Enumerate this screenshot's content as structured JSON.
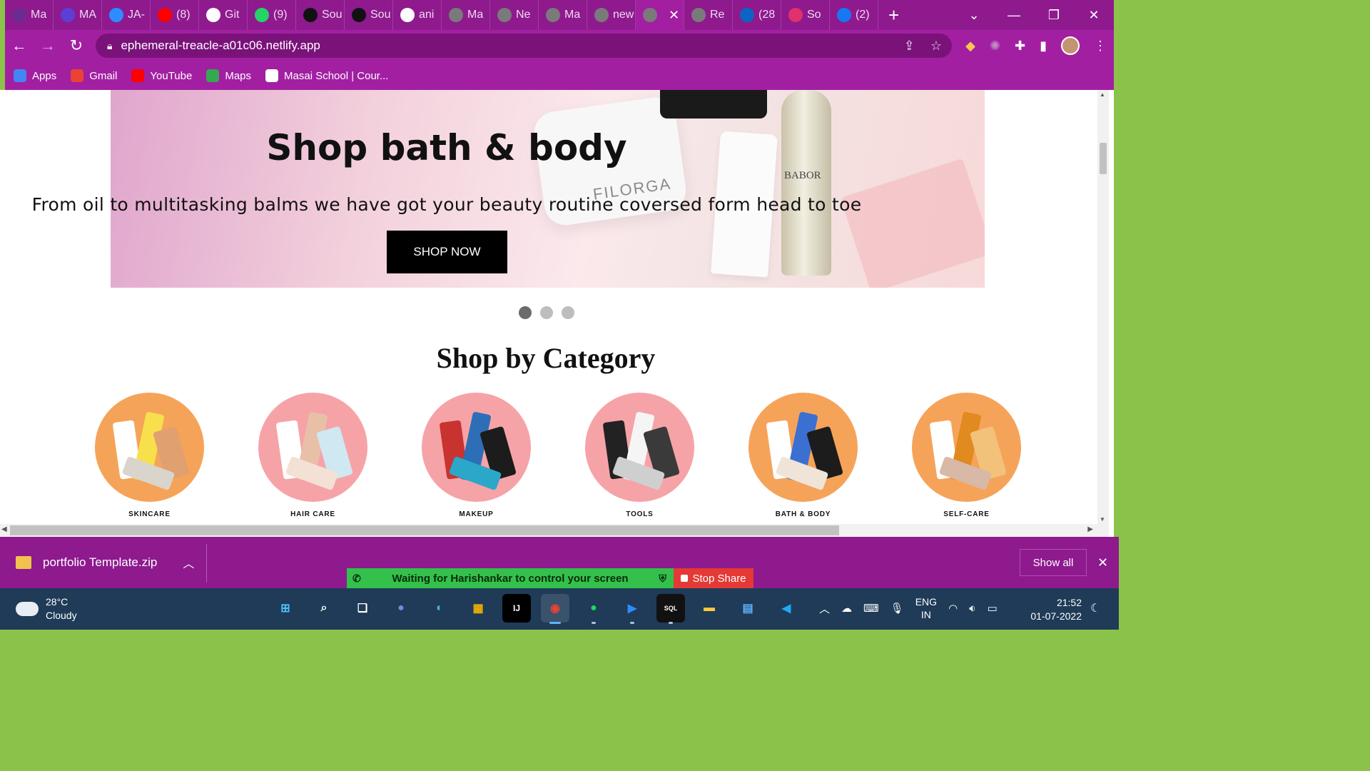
{
  "browser": {
    "tabs": [
      {
        "label": "Ma",
        "icon": "masai-icon",
        "color": "#6a2c91"
      },
      {
        "label": "MA",
        "icon": "list-icon",
        "color": "#5c3fd6"
      },
      {
        "label": "JA-",
        "icon": "zoom-icon",
        "color": "#2d8cff"
      },
      {
        "label": "(8)",
        "icon": "youtube-icon",
        "color": "#ff0000"
      },
      {
        "label": "Git",
        "icon": "mg-icon",
        "color": "#ffffff"
      },
      {
        "label": "(9)",
        "icon": "whatsapp-icon",
        "color": "#25d366"
      },
      {
        "label": "Sou",
        "icon": "github-icon",
        "color": "#111111"
      },
      {
        "label": "Sou",
        "icon": "github-icon",
        "color": "#111111"
      },
      {
        "label": "ani",
        "icon": "google-icon",
        "color": "#ffffff"
      },
      {
        "label": "Ma",
        "icon": "globe-icon",
        "color": "#7a7a7a"
      },
      {
        "label": "Ne",
        "icon": "chrome-icon",
        "color": "#7a7a7a"
      },
      {
        "label": "Ma",
        "icon": "globe-icon",
        "color": "#7a7a7a"
      },
      {
        "label": "new",
        "icon": "globe-icon",
        "color": "#7a7a7a"
      },
      {
        "label": "",
        "icon": "globe-icon",
        "color": "#7a7a7a",
        "active": true
      },
      {
        "label": "Re",
        "icon": "globe-icon",
        "color": "#7a7a7a"
      },
      {
        "label": "(28",
        "icon": "linkedin-icon",
        "color": "#0a66c2"
      },
      {
        "label": "So",
        "icon": "instagram-icon",
        "color": "#e1306c"
      },
      {
        "label": "(2)",
        "icon": "facebook-icon",
        "color": "#1877f2"
      }
    ],
    "url": "ephemeral-treacle-a01c06.netlify.app",
    "bookmarks": [
      {
        "label": "Apps",
        "color": "#4285f4"
      },
      {
        "label": "Gmail",
        "color": "#ea4335"
      },
      {
        "label": "YouTube",
        "color": "#ff0000"
      },
      {
        "label": "Maps",
        "color": "#34a853"
      },
      {
        "label": "Masai School | Cour...",
        "color": "#ffffff"
      }
    ]
  },
  "page": {
    "hero": {
      "title": "Shop bath & body",
      "subtitle": "From oil to multitasking balms we have got your beauty routine coversed form head to toe",
      "button": "SHOP NOW",
      "product_labels": {
        "filorga": "FILORGA",
        "babor": "BABOR"
      }
    },
    "category_heading": "Shop by Category",
    "categories": [
      {
        "label": "SKINCARE",
        "bg": "#f6a35a"
      },
      {
        "label": "HAIR CARE",
        "bg": "#f6a3a8"
      },
      {
        "label": "MAKEUP",
        "bg": "#f6a3a8"
      },
      {
        "label": "TOOLS",
        "bg": "#f6a3a8"
      },
      {
        "label": "BATH & BODY",
        "bg": "#f6a35a"
      },
      {
        "label": "SELF-CARE",
        "bg": "#f6a35a"
      }
    ]
  },
  "downloads": {
    "file": "portfolio Template.zip",
    "show_all": "Show all"
  },
  "screen_share": {
    "message": "Waiting for Harishankar to control your screen",
    "stop": "Stop Share"
  },
  "taskbar": {
    "weather_temp": "28°C",
    "weather_desc": "Cloudy",
    "lang1": "ENG",
    "lang2": "IN",
    "time": "21:52",
    "date": "01-07-2022"
  }
}
